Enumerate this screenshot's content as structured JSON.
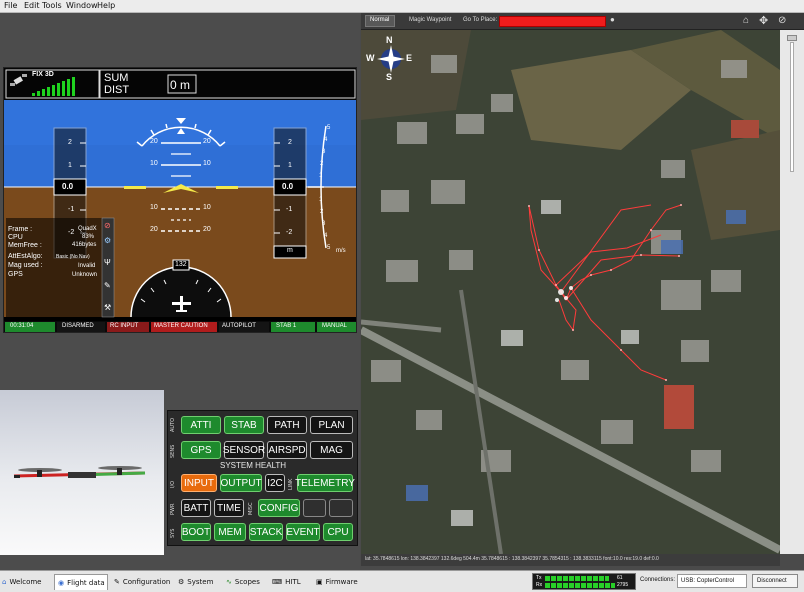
{
  "menu": [
    "File",
    "Edit",
    "Tools",
    "Window",
    "Help"
  ],
  "pfd": {
    "gps_fix": "FIX 3D",
    "sum_label": "SUM",
    "dist_label": "DIST",
    "dist_value": "0 m",
    "left_tape_value": "0.0",
    "right_tape_value": "0.0",
    "right_tape_unit": "m",
    "vs_unit": "m/s",
    "heading": "132",
    "pitch_labels": [
      "20",
      "10",
      "10",
      "20"
    ],
    "left_ticks": [
      "2",
      "1",
      "0",
      "-1",
      "-2"
    ],
    "right_ticks": [
      "2",
      "1",
      "0",
      "-1",
      "-2"
    ],
    "vs_ticks": [
      "5",
      "4",
      "3",
      "2",
      "1",
      "0",
      "1",
      "2",
      "3",
      "4",
      "5"
    ],
    "info": [
      {
        "label": "Frame :",
        "value": "QuadX"
      },
      {
        "label": "CPU",
        "value": "83%"
      },
      {
        "label": "MemFree :",
        "value": "416bytes"
      },
      {
        "label": "AttEstAlgo:",
        "value": "Basic (No Nav)"
      },
      {
        "label": "Mag used :",
        "value": "Invalid"
      },
      {
        "label": "GPS",
        "value": "Unknown"
      }
    ],
    "status": [
      {
        "label": "00:31:04",
        "color": "#1e8a2d"
      },
      {
        "label": "DISARMED",
        "color": "#141414"
      },
      {
        "label": "RC INPUT",
        "color": "#8a1a1a"
      },
      {
        "label": "MASTER CAUTION",
        "color": "#b01c1c"
      },
      {
        "label": "AUTOPILOT",
        "color": "#141414"
      },
      {
        "label": "STAB 1",
        "color": "#1e8a2d"
      },
      {
        "label": "MANUAL",
        "color": "#1e8a2d"
      }
    ]
  },
  "health": {
    "title": "SYSTEM HEALTH",
    "row_labels": [
      "AUTO",
      "SENS",
      "",
      "I/O",
      "PWR",
      "MISC",
      "SYS"
    ],
    "row1": [
      "ATTI",
      "STAB",
      "PATH",
      "PLAN"
    ],
    "row2": [
      "GPS",
      "SENSOR",
      "AIRSPD",
      "MAG"
    ],
    "row3": [
      "INPUT",
      "OUTPUT",
      "I2C",
      "TELEMETRY"
    ],
    "row3_sub": "LINK",
    "row4": [
      "BATT",
      "TIME",
      "CONFIG",
      "",
      ""
    ],
    "row5": [
      "BOOT",
      "MEM",
      "STACK",
      "EVENT",
      "CPU"
    ]
  },
  "map": {
    "toolbar_tabs": [
      "Normal",
      "Magic Waypoint"
    ],
    "goto_label": "Go To Place:",
    "goto_value": "",
    "compass": [
      "N",
      "S",
      "W",
      "E"
    ],
    "status_text": "lat: 35.7848615 lon: 138.3842397 132.6deg 504.4m   35.7848615 : 138.3842397   35.7854315 : 138.3833115   font:10.0 res:19.0 def:0.0"
  },
  "tabs": [
    "Welcome",
    "Flight data",
    "Configuration",
    "System",
    "Scopes",
    "HITL",
    "Firmware"
  ],
  "telemetry": {
    "tx_label": "Tx",
    "rx_label": "Rx",
    "tx_value": "61",
    "rx_value": "2795"
  },
  "connections": {
    "label": "Connections:",
    "device": "USB: CopterControl",
    "disconnect": "Disconnect"
  }
}
